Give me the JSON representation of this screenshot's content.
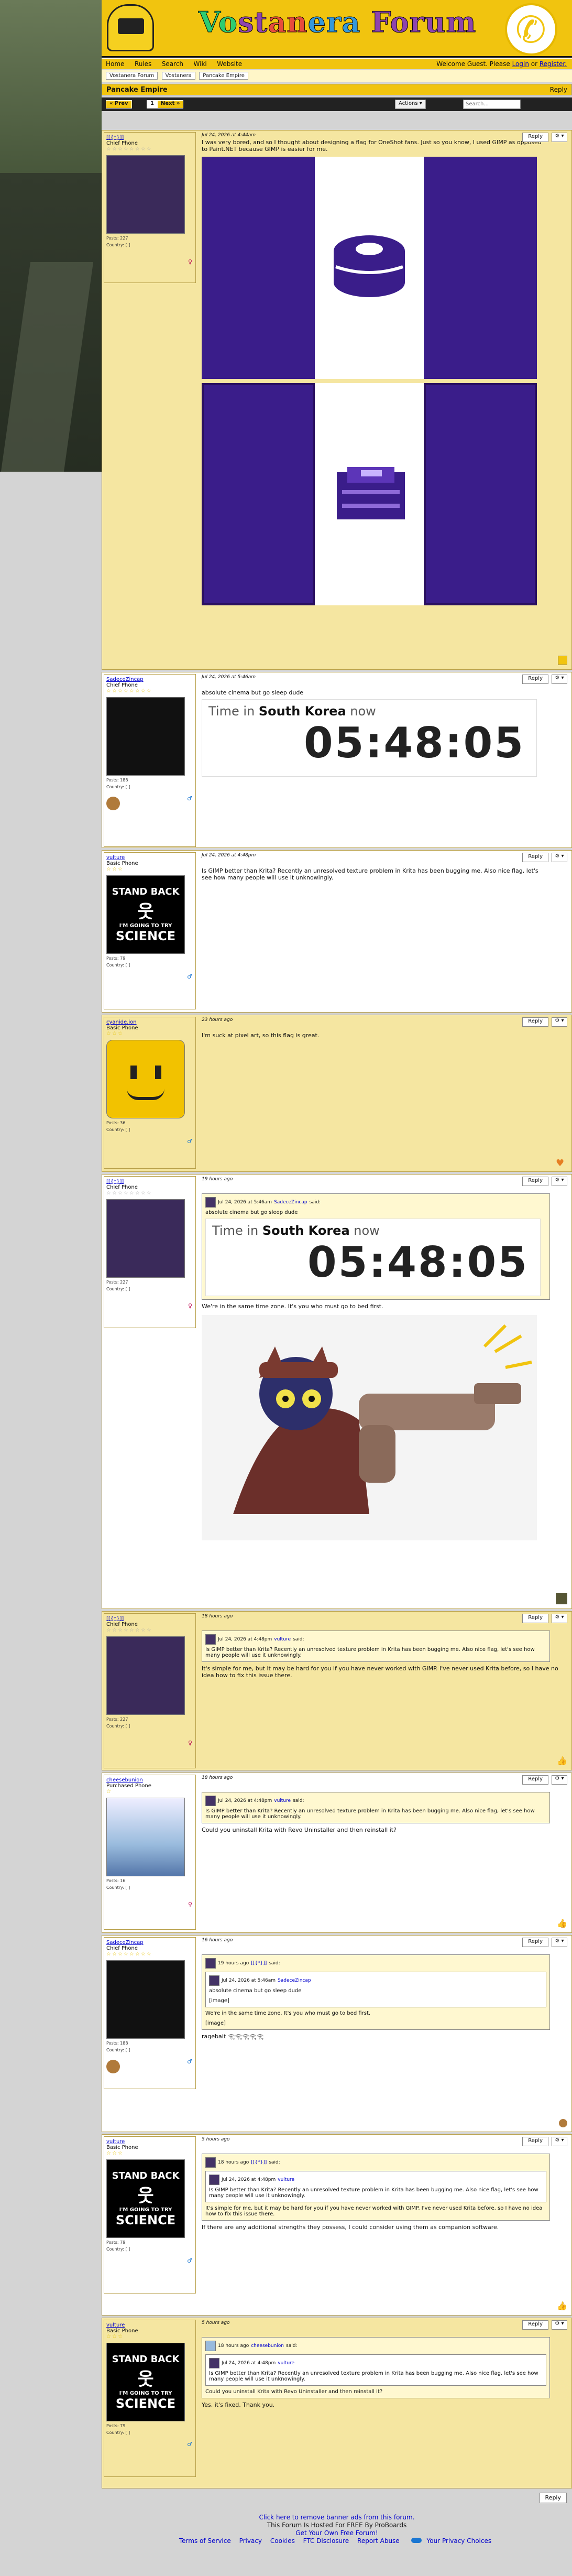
{
  "site": {
    "logo": "Vostanera Forum",
    "logo_parts": [
      "Vo",
      "st",
      "an",
      "era ",
      "Forum"
    ],
    "nav": [
      "Home",
      "Rules",
      "Search",
      "Wiki",
      "Website"
    ],
    "welcome_prefix": "Welcome Guest. Please",
    "login": "Login",
    "or": "or",
    "register": "Register."
  },
  "breadcrumbs": [
    "Vostanera Forum",
    "Vostanera",
    "Pancake Empire"
  ],
  "thread": {
    "title": "Pancake Empire",
    "reply_top": "Reply",
    "prev": "« Prev",
    "page": "1",
    "next": "Next »",
    "actions": "Actions",
    "search_placeholder": "Search..."
  },
  "posts": [
    {
      "user": "[[{*}]]",
      "rank": "Chief Phone",
      "stars": "☆☆☆☆☆☆☆☆",
      "posts": "Posts: 227",
      "country": "Country: [ ]",
      "gender": "♀",
      "date": "Jul 24, 2026 at 4:44am",
      "text": "I was very bored, and so I thought about designing a flag for OneShot fans. Just so you know, I used GIMP as opposed to Paint.NET because GIMP is easier for me.",
      "reply": "Reply",
      "opt": "⚙ ▾"
    },
    {
      "user": "SadeceZincap",
      "rank": "Chief Phone",
      "stars": "☆☆☆☆☆☆☆☆",
      "posts": "Posts: 188",
      "country": "Country: [ ]",
      "gender": "♂",
      "date": "Jul 24, 2026 at 5:46am",
      "text": "absolute cinema but go sleep dude",
      "time_label": "Time in",
      "time_place": "South Korea",
      "time_now": "now",
      "time": "05:48:05",
      "reply": "Reply",
      "opt": "⚙ ▾"
    },
    {
      "user": "vulture",
      "rank": "Basic Phone",
      "stars": "☆☆☆",
      "posts": "Posts: 79",
      "country": "Country: [ ]",
      "gender": "♂",
      "date": "Jul 24, 2026 at 4:48pm",
      "text": "Is GIMP better than Krita? Recently an unresolved texture problem in Krita has been bugging me. Also nice flag, let's see how many people will use it unknowingly.",
      "reply": "Reply",
      "opt": "⚙ ▾"
    },
    {
      "user": "cyanide.ion",
      "rank": "Basic Phone",
      "stars": "☆☆☆",
      "posts": "Posts: 36",
      "country": "Country: [ ]",
      "gender": "♂",
      "date": "23 hours ago",
      "text": "I'm suck at pixel art, so this flag is great.",
      "reply": "Reply",
      "opt": "⚙ ▾"
    },
    {
      "user": "[[{*}]]",
      "rank": "Chief Phone",
      "stars": "☆☆☆☆☆☆☆☆",
      "posts": "Posts: 227",
      "country": "Country: [ ]",
      "gender": "♀",
      "date": "19 hours ago",
      "q_date": "Jul 24, 2026 at 5:46am",
      "q_user": "SadeceZincap",
      "q_said": "said:",
      "q_text": "absolute cinema but go sleep dude",
      "time_label": "Time in",
      "time_place": "South Korea",
      "time_now": "now",
      "time": "05:48:05",
      "text": "We're in the same time zone. It's you who must go to bed first.",
      "reply": "Reply",
      "opt": "⚙ ▾"
    },
    {
      "user": "[[{*}]]",
      "rank": "Chief Phone",
      "stars": "☆☆☆☆☆☆☆☆",
      "posts": "Posts: 227",
      "country": "Country: [ ]",
      "gender": "♀",
      "date": "18 hours ago",
      "q_date": "Jul 24, 2026 at 4:48pm",
      "q_user": "vulture",
      "q_said": "said:",
      "q_text": "Is GIMP better than Krita? Recently an unresolved texture problem in Krita has been bugging me. Also nice flag, let's see how many people will use it unknowingly.",
      "text": "It's simple for me, but it may be hard for you if you have never worked with GIMP. I've never used Krita before, so I have no idea how to fix this issue there.",
      "reply": "Reply",
      "opt": "⚙ ▾"
    },
    {
      "user": "cheesebunion",
      "rank": "Purchased Phone",
      "stars": "☆",
      "posts": "Posts: 16",
      "country": "Country: [ ]",
      "gender": "♀",
      "date": "18 hours ago",
      "q_date": "Jul 24, 2026 at 4:48pm",
      "q_user": "vulture",
      "q_said": "said:",
      "q_text": "Is GIMP better than Krita? Recently an unresolved texture problem in Krita has been bugging me. Also nice flag, let's see how many people will use it unknowingly.",
      "text": "Could you uninstall Krita with Revo Uninstaller and then reinstall it?",
      "reply": "Reply",
      "opt": "⚙ ▾"
    },
    {
      "user": "SadeceZincap",
      "rank": "Chief Phone",
      "stars": "☆☆☆☆☆☆☆☆",
      "posts": "Posts: 188",
      "country": "Country: [ ]",
      "gender": "♂",
      "date": "16 hours ago",
      "q_date": "19 hours ago",
      "q_user": "[[{*}]]",
      "q_said": "said:",
      "q2_date": "Jul 24, 2026 at 5:46am",
      "q2_user": "SadeceZincap",
      "q2_text": "absolute cinema but go sleep dude",
      "img1": "[image]",
      "q_text": "We're in the same time zone. It's you who must go to bed first.",
      "img2": "[image]",
      "text": "ragebait 𓂀𓂀𓂀𓂀𓂀",
      "reply": "Reply",
      "opt": "⚙ ▾"
    },
    {
      "user": "vulture",
      "rank": "Basic Phone",
      "stars": "☆☆☆",
      "posts": "Posts: 79",
      "country": "Country: [ ]",
      "gender": "♂",
      "date": "5 hours ago",
      "q_date": "18 hours ago",
      "q_user": "[[{*}]]",
      "q_said": "said:",
      "q2_date": "Jul 24, 2026 at 4:48pm",
      "q2_user": "vulture",
      "q2_text": "Is GIMP better than Krita? Recently an unresolved texture problem in Krita has been bugging me. Also nice flag, let's see how many people will use it unknowingly.",
      "q_text": "It's simple for me, but it may be hard for you if you have never worked with GIMP. I've never used Krita before, so I have no idea how to fix this issue there.",
      "text": "If there are any additional strengths they possess, I could consider using them as companion software.",
      "reply": "Reply",
      "opt": "⚙ ▾"
    },
    {
      "user": "vulture",
      "rank": "Basic Phone",
      "stars": "☆☆☆",
      "posts": "Posts: 79",
      "country": "Country: [ ]",
      "gender": "♂",
      "date": "5 hours ago",
      "q_date": "18 hours ago",
      "q_user": "cheesebunion",
      "q_said": "said:",
      "q2_date": "Jul 24, 2026 at 4:48pm",
      "q2_user": "vulture",
      "q2_text": "Is GIMP better than Krita? Recently an unresolved texture problem in Krita has been bugging me. Also nice flag, let's see how many people will use it unknowingly.",
      "q_text": "Could you uninstall Krita with Revo Uninstaller and then reinstall it?",
      "text": "Yes, it's fixed. Thank you.",
      "reply": "Reply",
      "opt": "⚙ ▾"
    }
  ],
  "bottom_reply": "Reply",
  "footer": {
    "ad": "Click here to remove banner ads from this forum.",
    "hosted": "This Forum Is Hosted For FREE By ProBoards",
    "own": "Get Your Own Free Forum!",
    "links": [
      "Terms of Service",
      "Privacy",
      "Cookies",
      "FTC Disclosure",
      "Report Abuse",
      "Your Privacy Choices"
    ]
  },
  "avatar_text": {
    "stand": "STAND BACK",
    "going": "I'M GOING TO TRY",
    "science": "SCIENCE"
  }
}
